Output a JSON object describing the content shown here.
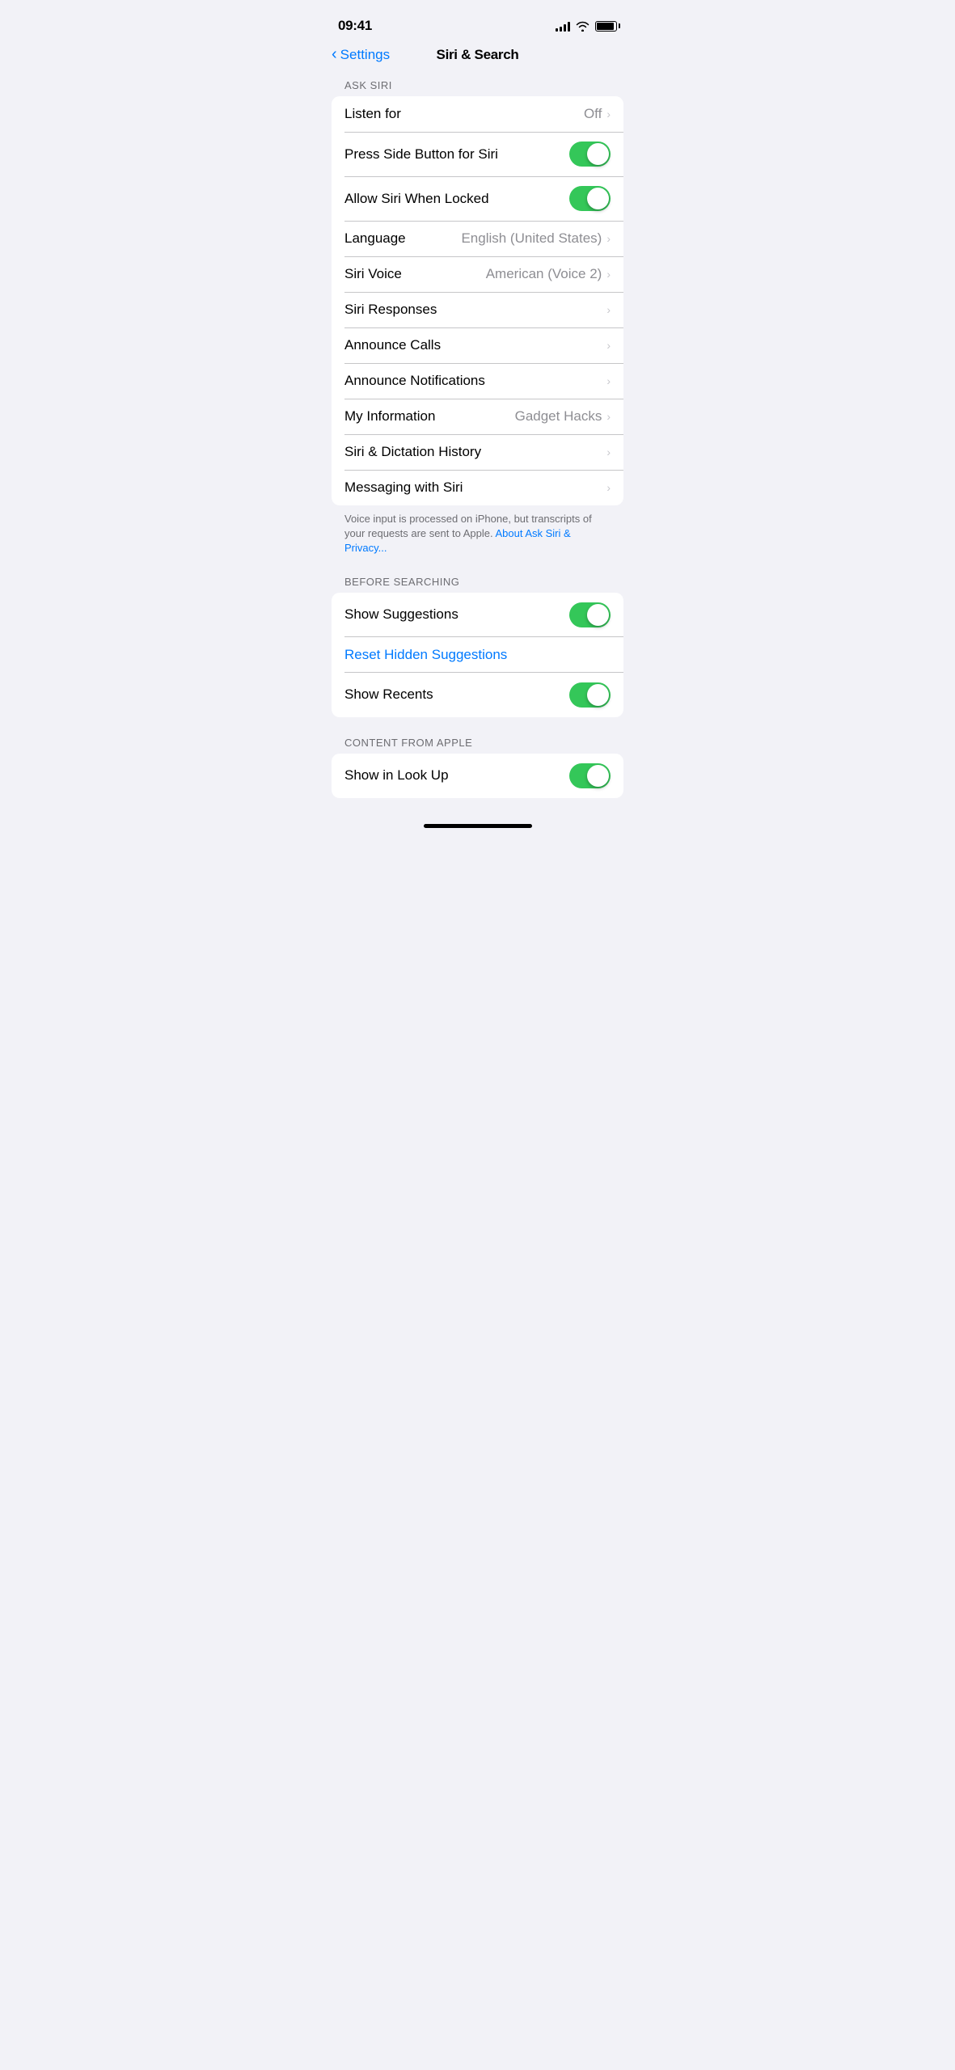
{
  "statusBar": {
    "time": "09:41",
    "signalBars": [
      4,
      6,
      8,
      10,
      12
    ],
    "batteryLevel": 90
  },
  "header": {
    "backLabel": "Settings",
    "title": "Siri & Search"
  },
  "sections": {
    "askSiri": {
      "header": "ASK SIRI",
      "items": [
        {
          "id": "listen-for",
          "label": "Listen for",
          "value": "Off",
          "type": "disclosure"
        },
        {
          "id": "press-side-button",
          "label": "Press Side Button for Siri",
          "value": "",
          "type": "toggle",
          "enabled": true
        },
        {
          "id": "allow-locked",
          "label": "Allow Siri When Locked",
          "value": "",
          "type": "toggle",
          "enabled": true
        },
        {
          "id": "language",
          "label": "Language",
          "value": "English (United States)",
          "type": "disclosure"
        },
        {
          "id": "siri-voice",
          "label": "Siri Voice",
          "value": "American (Voice 2)",
          "type": "disclosure"
        },
        {
          "id": "siri-responses",
          "label": "Siri Responses",
          "value": "",
          "type": "disclosure"
        },
        {
          "id": "announce-calls",
          "label": "Announce Calls",
          "value": "",
          "type": "disclosure"
        },
        {
          "id": "announce-notifications",
          "label": "Announce Notifications",
          "value": "",
          "type": "disclosure"
        },
        {
          "id": "my-information",
          "label": "My Information",
          "value": "Gadget Hacks",
          "type": "disclosure"
        },
        {
          "id": "siri-dictation-history",
          "label": "Siri & Dictation History",
          "value": "",
          "type": "disclosure"
        },
        {
          "id": "messaging-with-siri",
          "label": "Messaging with Siri",
          "value": "",
          "type": "disclosure"
        }
      ],
      "footer": {
        "text": "Voice input is processed on iPhone, but transcripts of your requests are sent to Apple. ",
        "linkText": "About Ask Siri & Privacy..."
      }
    },
    "beforeSearching": {
      "header": "BEFORE SEARCHING",
      "items": [
        {
          "id": "show-suggestions",
          "label": "Show Suggestions",
          "value": "",
          "type": "toggle",
          "enabled": true
        },
        {
          "id": "reset-hidden-suggestions",
          "label": "Reset Hidden Suggestions",
          "value": "",
          "type": "link"
        },
        {
          "id": "show-recents",
          "label": "Show Recents",
          "value": "",
          "type": "toggle",
          "enabled": true
        }
      ]
    },
    "contentFromApple": {
      "header": "CONTENT FROM APPLE",
      "items": [
        {
          "id": "show-in-look-up",
          "label": "Show in Look Up",
          "value": "",
          "type": "toggle",
          "enabled": true
        }
      ]
    }
  }
}
